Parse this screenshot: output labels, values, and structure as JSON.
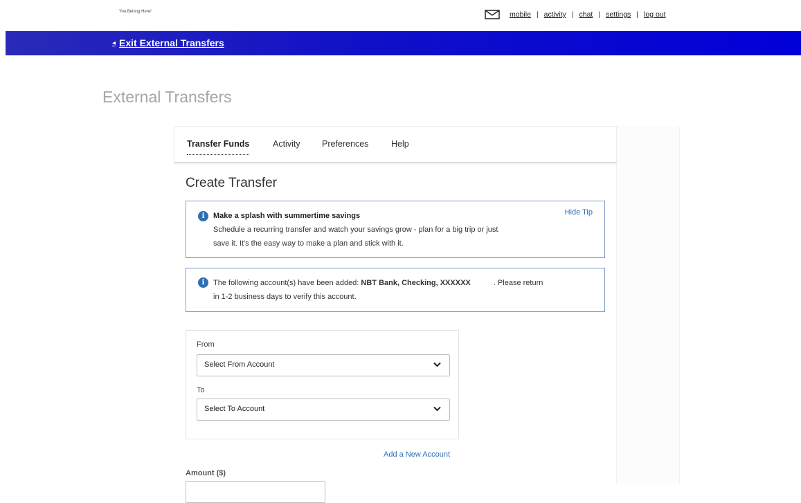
{
  "header": {
    "logo_text": "You Belong Here!",
    "links": [
      "mobile",
      "activity",
      "chat",
      "settings",
      "log out"
    ],
    "separator": "|"
  },
  "banner": {
    "exit_label": "Exit External Transfers",
    "color": "#1010c8"
  },
  "page": {
    "title": "External Transfers"
  },
  "tabs": [
    "Transfer Funds",
    "Activity",
    "Preferences",
    "Help"
  ],
  "active_tab": "Transfer Funds",
  "section_title": "Create Transfer",
  "tip": {
    "title": "Make a splash with summertime savings",
    "line1": "Schedule a recurring transfer and watch your savings grow - plan for a big trip or just",
    "line2": "save it. It's the easy way to make a plan and stick with it.",
    "hide_label": "Hide Tip"
  },
  "notice": {
    "prefix": "The following account(s) have been added:",
    "account": "NBT Bank, Checking, XXXXXX",
    "suffix": ". Please return",
    "line2": "in 1-2 business days to verify this account."
  },
  "form": {
    "from_label": "From",
    "from_value": "Select From Account",
    "to_label": "To",
    "to_value": "Select To Account",
    "add_account_label": "Add a New Account",
    "amount_label": "Amount ($)",
    "amount_value": ""
  },
  "colors": {
    "accent": "#2f6fb5",
    "info_border": "#7a95c9",
    "banner": "#1010c8"
  },
  "icons": {
    "mail": "mail-icon",
    "info": "info-icon",
    "chevron": "chevron-down-icon",
    "back": "chevron-left-icon"
  }
}
